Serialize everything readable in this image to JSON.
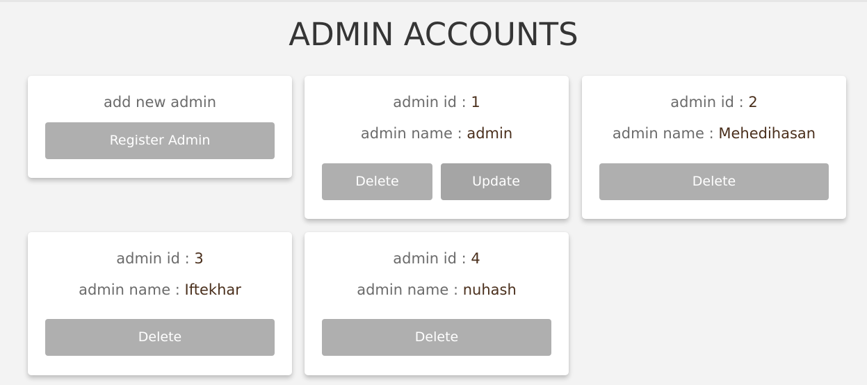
{
  "page": {
    "title": "ADMIN ACCOUNTS"
  },
  "add_card": {
    "label": "add new admin",
    "button_label": "Register Admin"
  },
  "labels": {
    "id_label": "admin id : ",
    "name_label": "admin name : ",
    "delete_label": "Delete",
    "update_label": "Update"
  },
  "admins": [
    {
      "id": "1",
      "name": "admin"
    },
    {
      "id": "2",
      "name": "Mehedihasan"
    },
    {
      "id": "3",
      "name": "Iftekhar"
    },
    {
      "id": "4",
      "name": "nuhash"
    }
  ],
  "colors": {
    "background": "#f3f3f3",
    "button": "#afafaf",
    "value_text": "#4a2f1c",
    "label_text": "#6b6b6b"
  }
}
